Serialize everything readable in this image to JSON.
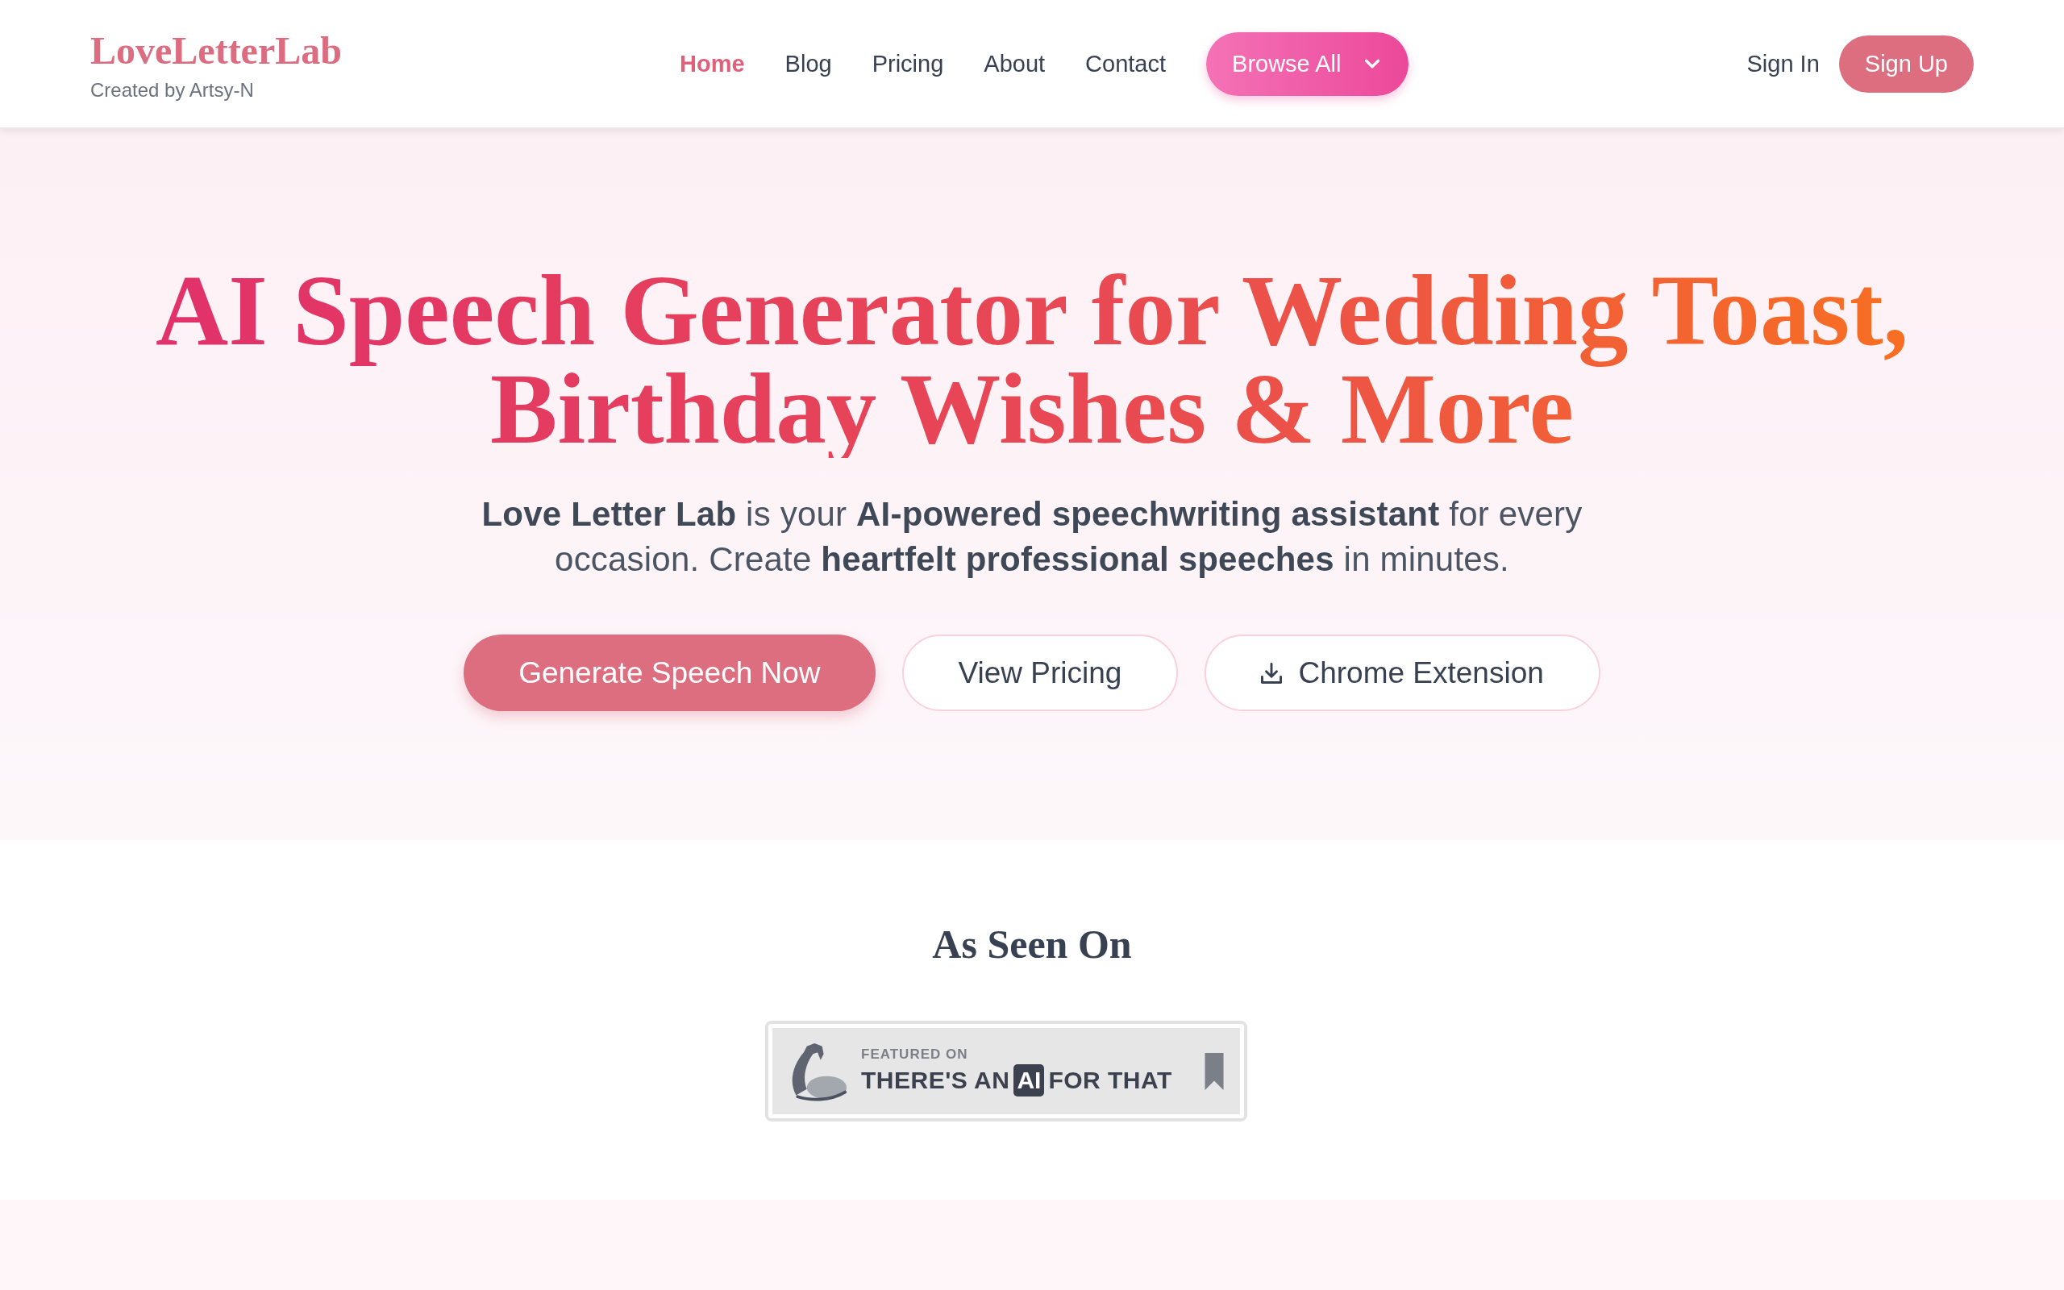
{
  "header": {
    "logo": "LoveLetterLab",
    "tagline": "Created by Artsy-N",
    "nav": [
      {
        "label": "Home",
        "selected": true
      },
      {
        "label": "Blog",
        "selected": false
      },
      {
        "label": "Pricing",
        "selected": false
      },
      {
        "label": "About",
        "selected": false
      },
      {
        "label": "Contact",
        "selected": false
      }
    ],
    "browse_button": "Browse All",
    "sign_in": "Sign In",
    "sign_up": "Sign Up"
  },
  "hero": {
    "title": "AI Speech Generator for Wedding Toast, Birthday Wishes & More",
    "intro": "**Love Letter Lab** is your **AI-powered speechwriting assistant** for every occasion. Create **heartfelt professional speeches** in minutes.",
    "buttons": [
      {
        "label": "Generate Speech Now",
        "kind": "primary"
      },
      {
        "label": "View Pricing",
        "kind": "outline"
      },
      {
        "label": "Chrome Extension",
        "kind": "download"
      }
    ]
  },
  "featured": {
    "heading": "As Seen On",
    "badge": {
      "caption": "FEATURED ON",
      "title_before": "THERE'S AN",
      "highlight": "AI",
      "title_after": "FOR THAT"
    }
  }
}
